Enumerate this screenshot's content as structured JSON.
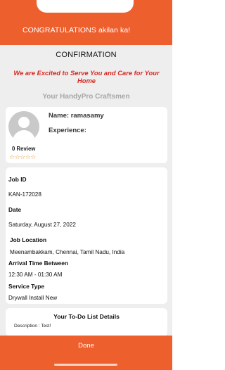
{
  "banner": {
    "text": "CONGRATULATIONS akilan ka!"
  },
  "confirmation": {
    "title": "CONFIRMATION",
    "tagline": "We are Excited to Serve You and Care for Your Home",
    "craftsmen_heading": "Your HandyPro Craftsmen"
  },
  "profile": {
    "avatar_icon": "user-avatar-placeholder-icon",
    "name_label": "Name:",
    "name_value": "ramasamy",
    "experience_label": "Experience:",
    "experience_value": "",
    "review_count": "0 Review",
    "stars": "☆☆☆☆☆",
    "rating": 0
  },
  "job": {
    "id_label": "Job ID",
    "id_value": "KAN-172028",
    "date_label": "Date",
    "date_value": "Saturday, August 27, 2022",
    "location_label": "Job Location",
    "location_value": "Meenambakkam, Chennai, Tamil Nadu, India",
    "arrival_label": "Arrival Time Between",
    "arrival_value": "12:30 AM - 01:30 AM",
    "service_label": "Service Type",
    "service_value": "Drywall Install New"
  },
  "todo": {
    "title": "Your To-Do List Details",
    "description": "Description : Test!"
  },
  "footer": {
    "done_label": "Done"
  },
  "colors": {
    "accent": "#ee5f2e",
    "tagline": "#d8271f",
    "background": "#efeeef",
    "muted": "#a7a7a7"
  }
}
